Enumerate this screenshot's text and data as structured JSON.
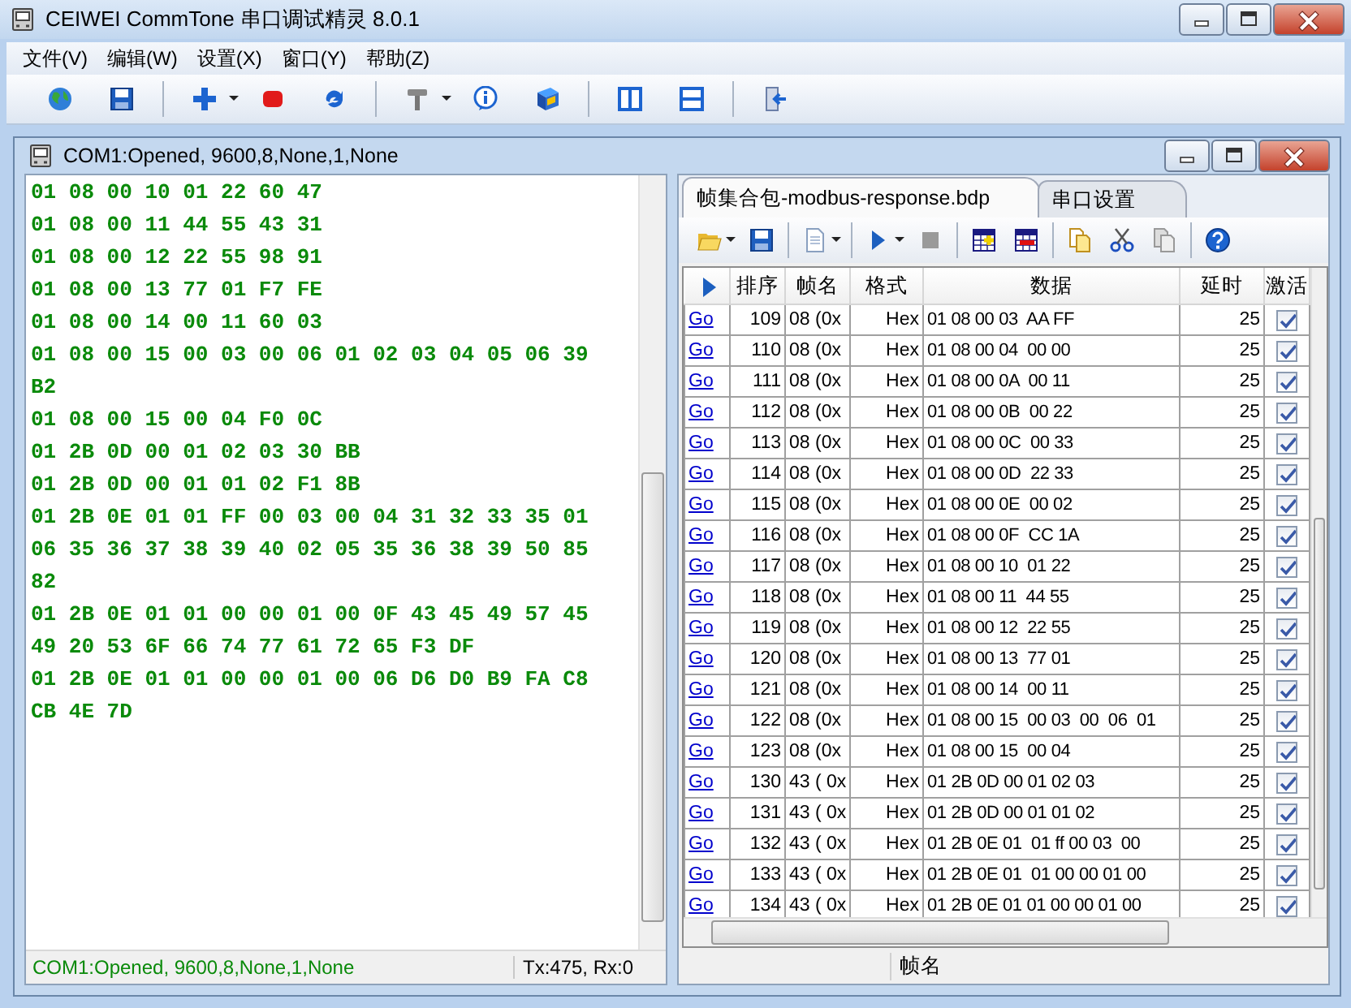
{
  "window": {
    "title": "CEIWEI CommTone 串口调试精灵 8.0.1"
  },
  "menu": [
    "文件(V)",
    "编辑(W)",
    "设置(X)",
    "窗口(Y)",
    "帮助(Z)"
  ],
  "child_window": {
    "title": "COM1:Opened, 9600,8,None,1,None",
    "hex_lines": [
      "01 08 00 10 01 22 60 47",
      "01 08 00 11 44 55 43 31",
      "01 08 00 12 22 55 98 91",
      "01 08 00 13 77 01 F7 FE",
      "01 08 00 14 00 11 60 03",
      "01 08 00 15 00 03 00 06 01 02 03 04 05 06 39",
      "B2",
      "01 08 00 15 00 04 F0 0C",
      "01 2B 0D 00 01 02 03 30 BB",
      "01 2B 0D 00 01 01 02 F1 8B",
      "01 2B 0E 01 01 FF 00 03 00 04 31 32 33 35 01",
      "06 35 36 37 38 39 40 02 05 35 36 38 39 50 85",
      "82",
      "01 2B 0E 01 01 00 00 01 00 0F 43 45 49 57 45",
      "49 20 53 6F 66 74 77 61 72 65 F3 DF",
      "01 2B 0E 01 01 00 00 01 00 06 D6 D0 B9 FA C8",
      "CB 4E 7D"
    ],
    "status_bar": {
      "connection": "COM1:Opened, 9600,8,None,1,None",
      "counters": "Tx:475, Rx:0"
    }
  },
  "frame_panel": {
    "tabs": [
      {
        "label": "帧集合包-modbus-response.bdp",
        "selected": true
      },
      {
        "label": "串口设置",
        "selected": false
      }
    ],
    "columns": [
      "排序",
      "帧名",
      "格式",
      "数据",
      "延时",
      "激活"
    ],
    "rows": [
      {
        "link": "Go",
        "order": "109",
        "name": "08 (0x",
        "format": "Hex",
        "data": "01 08 00 03  AA FF",
        "delay": "25",
        "active": true
      },
      {
        "link": "Go",
        "order": "110",
        "name": "08 (0x",
        "format": "Hex",
        "data": "01 08 00 04  00 00",
        "delay": "25",
        "active": true
      },
      {
        "link": "Go",
        "order": "111",
        "name": "08 (0x",
        "format": "Hex",
        "data": "01 08 00 0A  00 11",
        "delay": "25",
        "active": true
      },
      {
        "link": "Go",
        "order": "112",
        "name": "08 (0x",
        "format": "Hex",
        "data": "01 08 00 0B  00 22",
        "delay": "25",
        "active": true
      },
      {
        "link": "Go",
        "order": "113",
        "name": "08 (0x",
        "format": "Hex",
        "data": "01 08 00 0C  00 33",
        "delay": "25",
        "active": true
      },
      {
        "link": "Go",
        "order": "114",
        "name": "08 (0x",
        "format": "Hex",
        "data": "01 08 00 0D  22 33",
        "delay": "25",
        "active": true
      },
      {
        "link": "Go",
        "order": "115",
        "name": "08 (0x",
        "format": "Hex",
        "data": "01 08 00 0E  00 02",
        "delay": "25",
        "active": true
      },
      {
        "link": "Go",
        "order": "116",
        "name": "08 (0x",
        "format": "Hex",
        "data": "01 08 00 0F  CC 1A",
        "delay": "25",
        "active": true
      },
      {
        "link": "Go",
        "order": "117",
        "name": "08 (0x",
        "format": "Hex",
        "data": "01 08 00 10  01 22",
        "delay": "25",
        "active": true
      },
      {
        "link": "Go",
        "order": "118",
        "name": "08 (0x",
        "format": "Hex",
        "data": "01 08 00 11  44 55",
        "delay": "25",
        "active": true
      },
      {
        "link": "Go",
        "order": "119",
        "name": "08 (0x",
        "format": "Hex",
        "data": "01 08 00 12  22 55",
        "delay": "25",
        "active": true
      },
      {
        "link": "Go",
        "order": "120",
        "name": "08 (0x",
        "format": "Hex",
        "data": "01 08 00 13  77 01",
        "delay": "25",
        "active": true
      },
      {
        "link": "Go",
        "order": "121",
        "name": "08 (0x",
        "format": "Hex",
        "data": "01 08 00 14  00 11",
        "delay": "25",
        "active": true
      },
      {
        "link": "Go",
        "order": "122",
        "name": "08 (0x",
        "format": "Hex",
        "data": "01 08 00 15  00 03  00  06  01",
        "delay": "25",
        "active": true
      },
      {
        "link": "Go",
        "order": "123",
        "name": "08 (0x",
        "format": "Hex",
        "data": "01 08 00 15  00 04",
        "delay": "25",
        "active": true
      },
      {
        "link": "Go",
        "order": "130",
        "name": "43 ( 0x",
        "format": "Hex",
        "data": "01 2B 0D 00 01 02 03",
        "delay": "25",
        "active": true
      },
      {
        "link": "Go",
        "order": "131",
        "name": "43 ( 0x",
        "format": "Hex",
        "data": "01 2B 0D 00 01 01 02",
        "delay": "25",
        "active": true
      },
      {
        "link": "Go",
        "order": "132",
        "name": "43 ( 0x",
        "format": "Hex",
        "data": "01 2B 0E 01  01 ff 00 03  00",
        "delay": "25",
        "active": true
      },
      {
        "link": "Go",
        "order": "133",
        "name": "43 ( 0x",
        "format": "Hex",
        "data": "01 2B 0E 01  01 00 00 01 00",
        "delay": "25",
        "active": true
      },
      {
        "link": "Go",
        "order": "134",
        "name": "43 ( 0x",
        "format": "Hex",
        "data": "01 2B 0E 01 01 00 00 01 00",
        "delay": "25",
        "active": true
      }
    ],
    "status_bar": {
      "field": "帧名"
    }
  }
}
